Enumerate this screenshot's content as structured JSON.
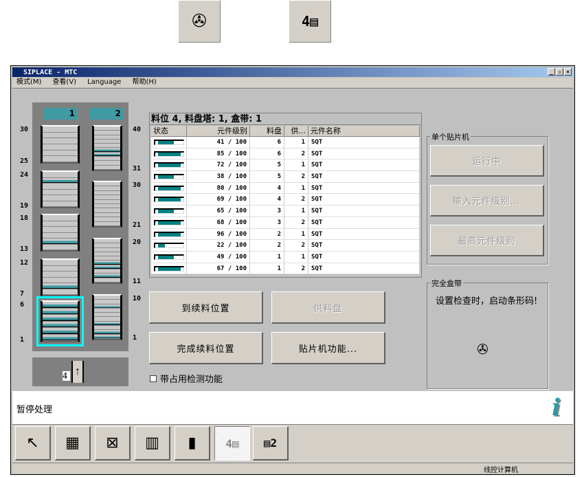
{
  "top_toolbar": [
    {
      "icon": "reel-barcode-icon"
    },
    {
      "icon": "tower-4-icon"
    }
  ],
  "window": {
    "title": "SIPLACE - MTC",
    "controls": [
      "_",
      "▫",
      "×"
    ]
  },
  "menu": [
    "模式(M)",
    "查看(V)",
    "Language",
    "帮助(H)"
  ],
  "tower": {
    "columns": [
      {
        "label": "1",
        "magazines": [
          {
            "top": "30",
            "bottom": "25",
            "slots": 6,
            "filled": []
          },
          {
            "top": "24",
            "bottom": "19",
            "slots": 6,
            "filled": [
              1
            ]
          },
          {
            "top": "18",
            "bottom": "13",
            "slots": 6,
            "filled": [
              4
            ]
          },
          {
            "top": "12",
            "bottom": "7",
            "slots": 6,
            "filled": [
              4
            ]
          },
          {
            "top": "6",
            "bottom": "1",
            "slots": 6,
            "filled": [
              0,
              1,
              2,
              3,
              4,
              5
            ],
            "selected": true
          }
        ]
      },
      {
        "label": "2",
        "magazines": [
          {
            "top": "40",
            "bottom": "31",
            "slots": 10,
            "filled": [
              5,
              6
            ]
          },
          {
            "top": "30",
            "bottom": "21",
            "slots": 10,
            "filled": []
          },
          {
            "top": "20",
            "bottom": "11",
            "slots": 10,
            "filled": [
              5,
              6,
              8
            ]
          },
          {
            "top": "10",
            "bottom": "1",
            "slots": 10,
            "filled": [
              2,
              6,
              8,
              9
            ]
          }
        ]
      }
    ],
    "elevator_level": "4"
  },
  "table": {
    "caption": "料位 4, 料盘塔: 1, 盒带: 1",
    "headers": [
      "状态",
      "元件级别",
      "料盘",
      "供...",
      "元件名称"
    ],
    "rows": [
      {
        "fill": 0.7,
        "level": "41 / 100",
        "tray": "6",
        "feeder": "1",
        "name": "SQT"
      },
      {
        "fill": 1,
        "level": "85 / 100",
        "tray": "6",
        "feeder": "2",
        "name": "SQT"
      },
      {
        "fill": 1,
        "level": "72 / 100",
        "tray": "5",
        "feeder": "1",
        "name": "SQT"
      },
      {
        "fill": 0.7,
        "level": "38 / 100",
        "tray": "5",
        "feeder": "2",
        "name": "SQT"
      },
      {
        "fill": 1,
        "level": "80 / 100",
        "tray": "4",
        "feeder": "1",
        "name": "SQT"
      },
      {
        "fill": 1,
        "level": "69 / 100",
        "tray": "4",
        "feeder": "2",
        "name": "SQT"
      },
      {
        "fill": 0.7,
        "level": "65 / 100",
        "tray": "3",
        "feeder": "1",
        "name": "SQT"
      },
      {
        "fill": 1,
        "level": "68 / 100",
        "tray": "3",
        "feeder": "2",
        "name": "SQT"
      },
      {
        "fill": 1,
        "level": "96 / 100",
        "tray": "2",
        "feeder": "1",
        "name": "SQT"
      },
      {
        "fill": 0.3,
        "level": "22 / 100",
        "tray": "2",
        "feeder": "2",
        "name": "SQT"
      },
      {
        "fill": 0.7,
        "level": "49 / 100",
        "tray": "1",
        "feeder": "1",
        "name": "SQT"
      },
      {
        "fill": 1,
        "level": "67 / 100",
        "tray": "1",
        "feeder": "2",
        "name": "SQT"
      }
    ]
  },
  "buttons": {
    "goto_refill": "到续料位置",
    "supply_tray": "供料盘",
    "finish_refill": "完成续料位置",
    "machine_func": "贴片机功能..."
  },
  "checkbox": {
    "label": "带占用检测功能",
    "checked": false
  },
  "single_machine": {
    "title": "单个贴片机",
    "running": "运行中",
    "enter_level": "输入元件级别...",
    "max_level": "最高元件级别"
  },
  "full_cassette": {
    "title": "完全盒带",
    "message": "设置检查时，启动条形码!"
  },
  "status": "暂停处理",
  "bottom_tools": [
    "select",
    "tower-list",
    "tower-cross",
    "grid",
    "reel-strip",
    "tower-4",
    "tower-2"
  ],
  "statusbar": "线控计算机",
  "colors": {
    "teal": "#3f9aa2",
    "bar": "#008080",
    "select": "#00ffff"
  }
}
